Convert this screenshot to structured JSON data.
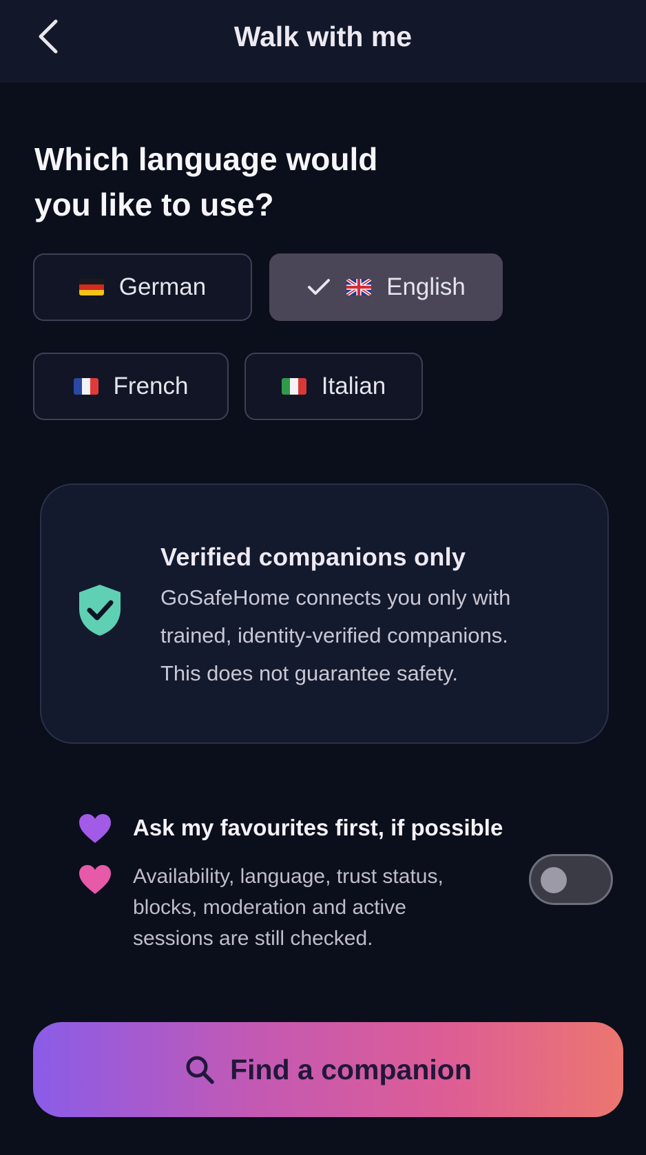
{
  "header": {
    "title": "Walk with me",
    "back_icon": "chevron-left-icon"
  },
  "question": {
    "line1": "Which language would",
    "line2": "you like to use?"
  },
  "languages": [
    {
      "label": "German",
      "flag": "flag-de",
      "selected": false
    },
    {
      "label": "English",
      "flag": "flag-uk",
      "selected": true
    },
    {
      "label": "French",
      "flag": "flag-fr",
      "selected": false
    },
    {
      "label": "Italian",
      "flag": "flag-it",
      "selected": false
    }
  ],
  "info_card": {
    "icon": "shield-check-icon",
    "title": "Verified companions only",
    "lines": [
      "GoSafeHome connects you only with",
      "trained, identity-verified companions.",
      "This does not guarantee safety."
    ]
  },
  "favourites": {
    "title": "Ask my favourites first, if possible",
    "lines": [
      "Availability, language, trust status,",
      "blocks, moderation and active",
      "sessions are still checked."
    ],
    "toggle_on": false
  },
  "cta": {
    "label": "Find a companion",
    "icon": "search-icon"
  },
  "colors": {
    "background": "#0b0e1b",
    "header": "#121829",
    "selected_chip": "#4a4658",
    "shield": "#5fd0b4",
    "heart_purple": "#a25be6",
    "heart_pink": "#e65aa8",
    "cta_start": "#8a5ce8",
    "cta_end": "#ec7670"
  }
}
